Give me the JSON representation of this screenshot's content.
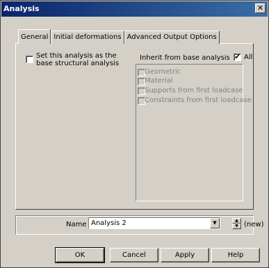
{
  "window": {
    "title": "Analysis",
    "close_glyph": "✕"
  },
  "tabs": [
    {
      "label": "General",
      "active": true
    },
    {
      "label": "Initial deformations",
      "active": false
    },
    {
      "label": "Advanced Output Options",
      "active": false
    }
  ],
  "general": {
    "base_analysis_label": "Set this analysis as the base structural analysis",
    "base_analysis_checked": false,
    "inherit_label": "Inherit from base analysis",
    "all_label": "All",
    "all_checked": true,
    "inherit_items": [
      {
        "label": "Geometric",
        "checked": false,
        "enabled": false
      },
      {
        "label": "Material",
        "checked": false,
        "enabled": false
      },
      {
        "label": "Supports from first loadcase",
        "checked": false,
        "enabled": false
      },
      {
        "label": "Constraints from first loadcase",
        "checked": false,
        "enabled": false
      }
    ]
  },
  "name_row": {
    "label": "Name",
    "value": "Analysis 2",
    "status": "(new)"
  },
  "buttons": {
    "ok": "OK",
    "cancel": "Cancel",
    "apply": "Apply",
    "help": "Help"
  },
  "icons": {
    "dropdown": "▼",
    "spin_up": "▲",
    "spin_down": "▼",
    "check": "✔"
  }
}
